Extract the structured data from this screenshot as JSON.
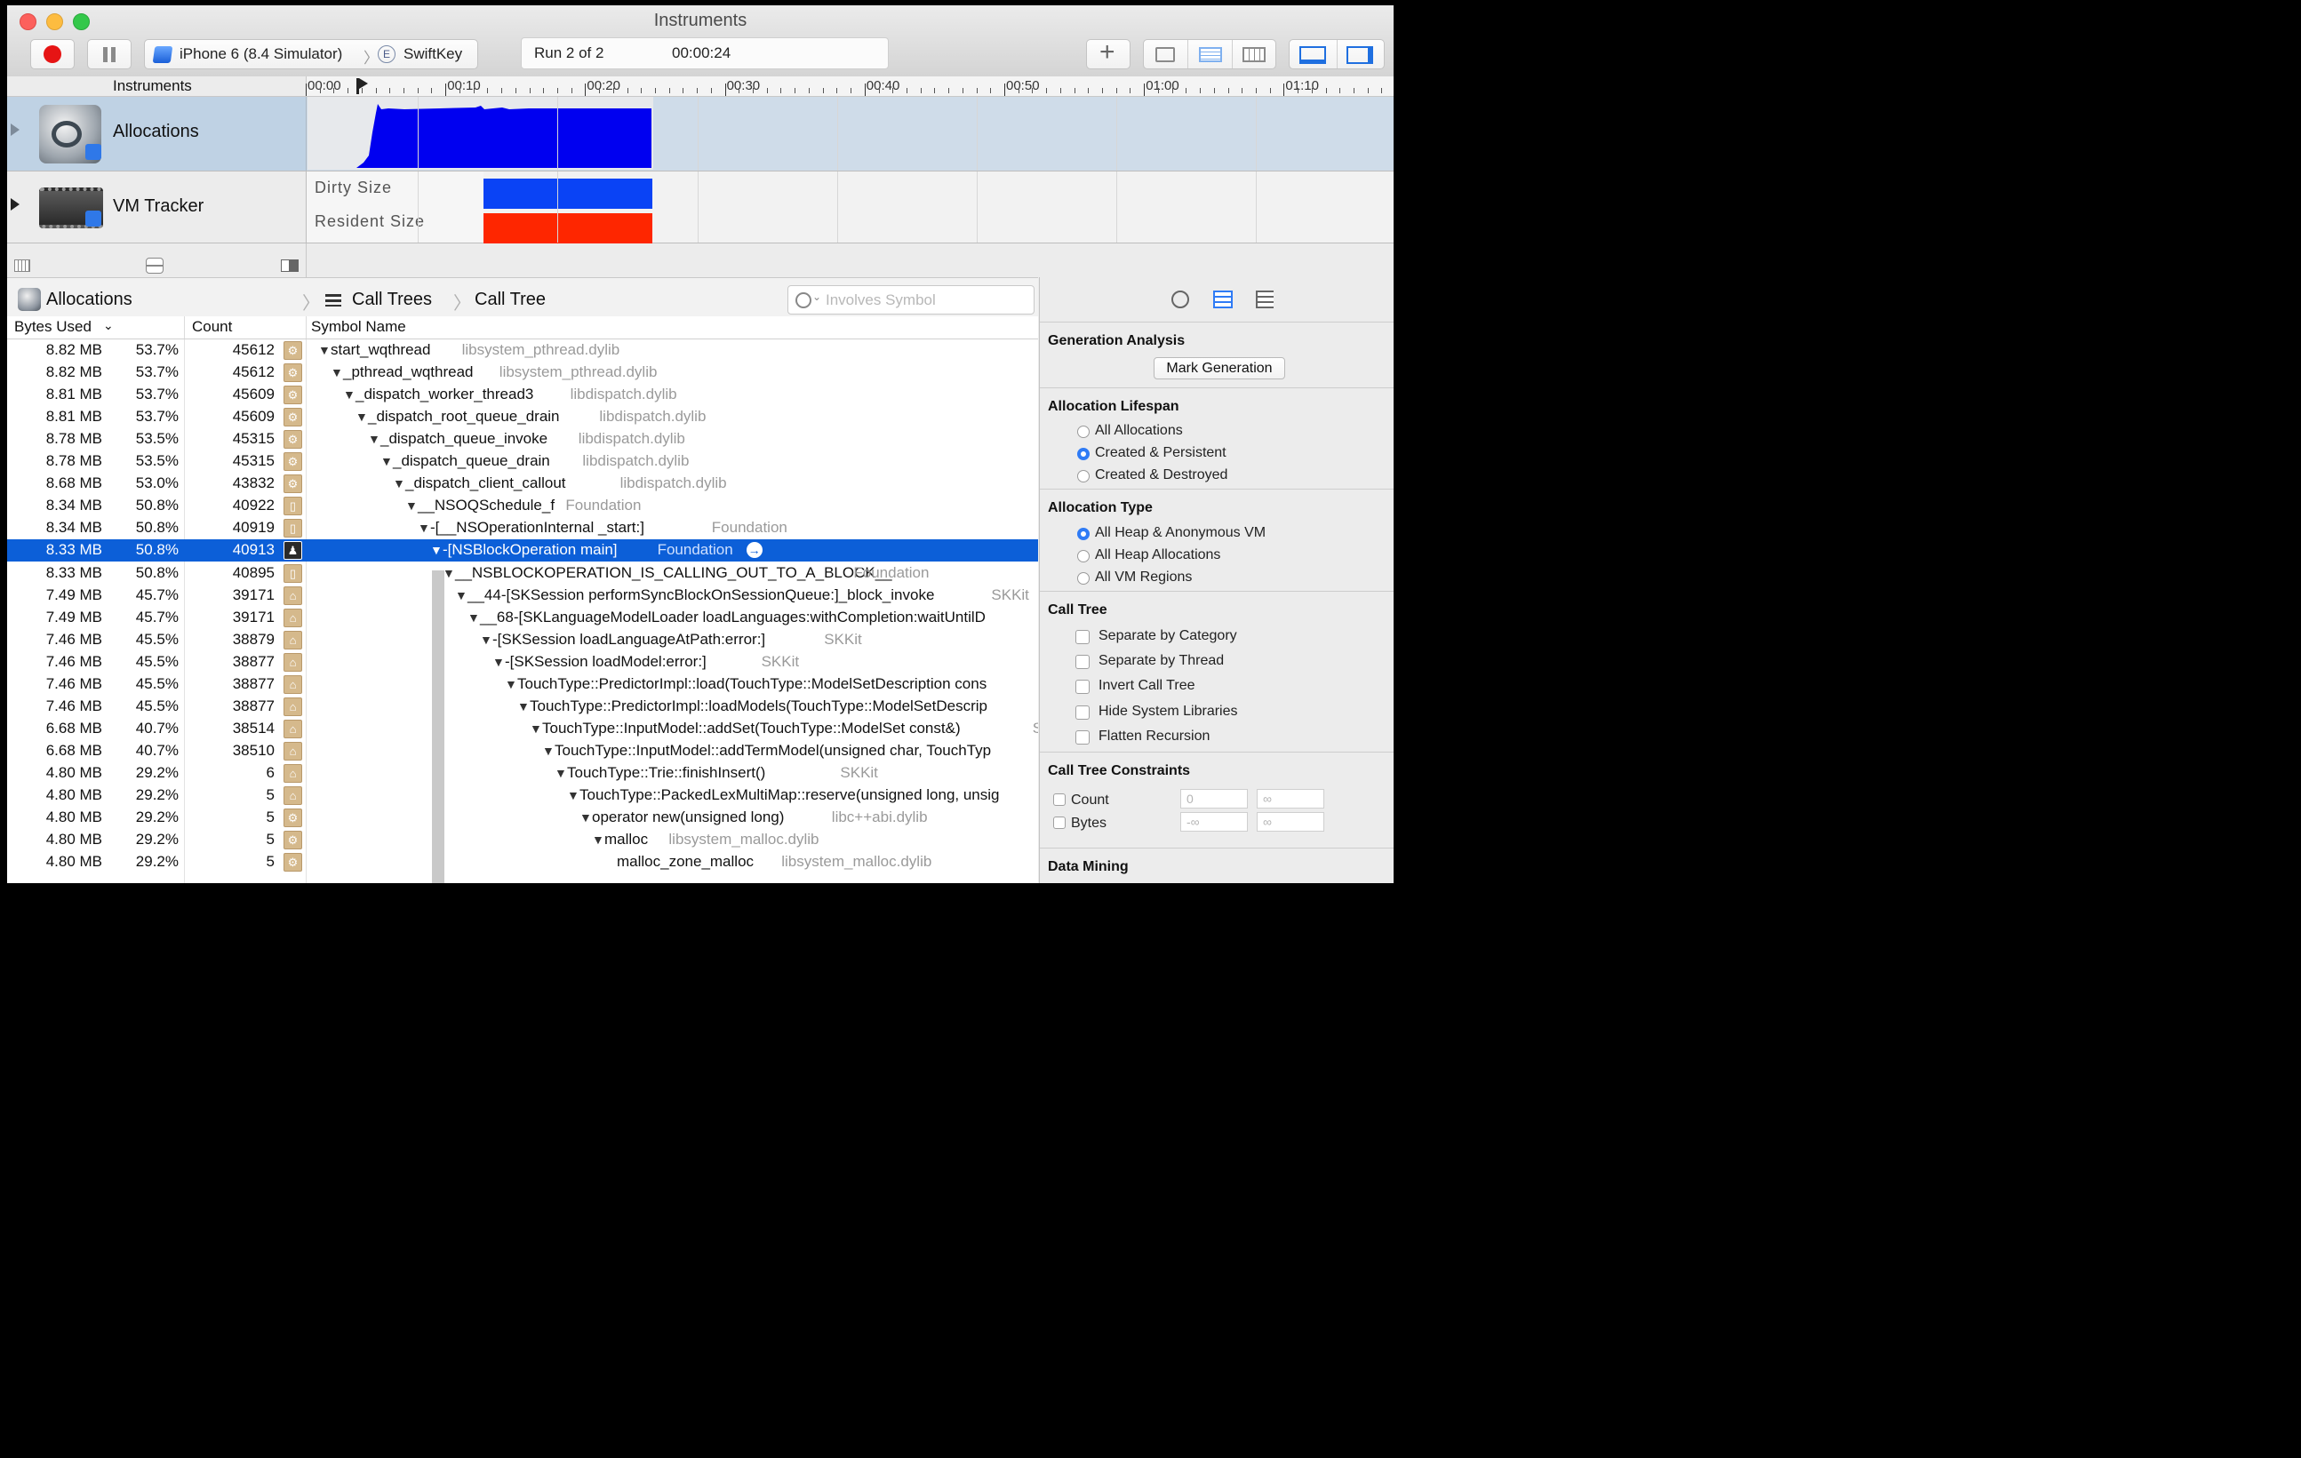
{
  "window": {
    "title": "Instruments"
  },
  "toolbar": {
    "device": "iPhone 6 (8.4 Simulator)",
    "target_badge": "E",
    "target": "SwiftKey",
    "run": "Run 2 of 2",
    "time": "00:00:24",
    "add": "+"
  },
  "timeline": {
    "header": "Instruments",
    "ticks": [
      "00:00",
      "00:10",
      "00:20",
      "00:30",
      "00:40",
      "00:50",
      "01:00",
      "01:10"
    ]
  },
  "tracks": {
    "allocations": "Allocations",
    "vm_tracker": "VM Tracker",
    "dirty_size": "Dirty Size",
    "resident_size": "Resident Size"
  },
  "colors": {
    "allocations_fill": "#0000f0",
    "dirty": "#0a43f5",
    "resident": "#fe2600",
    "selection": "#0c5fd8"
  },
  "navbar": {
    "instrument": "Allocations",
    "view": "Call Trees",
    "subview": "Call Tree",
    "search_placeholder": "Involves Symbol"
  },
  "columns": {
    "bytes": "Bytes Used",
    "count": "Count",
    "symbol": "Symbol Name"
  },
  "rows": [
    {
      "bytes": "8.82 MB",
      "pct": "53.7%",
      "count": "45612",
      "sym": "start_wqthread",
      "lib": "libsystem_pthread.dylib",
      "icon": "gear",
      "depth": 0,
      "arrow": "▼"
    },
    {
      "bytes": "8.82 MB",
      "pct": "53.7%",
      "count": "45612",
      "sym": "_pthread_wqthread",
      "lib": "libsystem_pthread.dylib",
      "icon": "gear",
      "depth": 1,
      "arrow": "▼"
    },
    {
      "bytes": "8.81 MB",
      "pct": "53.7%",
      "count": "45609",
      "sym": "_dispatch_worker_thread3",
      "lib": "libdispatch.dylib",
      "icon": "gear",
      "depth": 2,
      "arrow": "▼"
    },
    {
      "bytes": "8.81 MB",
      "pct": "53.7%",
      "count": "45609",
      "sym": "_dispatch_root_queue_drain",
      "lib": "libdispatch.dylib",
      "icon": "gear",
      "depth": 3,
      "arrow": "▼"
    },
    {
      "bytes": "8.78 MB",
      "pct": "53.5%",
      "count": "45315",
      "sym": "_dispatch_queue_invoke",
      "lib": "libdispatch.dylib",
      "icon": "gear",
      "depth": 4,
      "arrow": "▼"
    },
    {
      "bytes": "8.78 MB",
      "pct": "53.5%",
      "count": "45315",
      "sym": "_dispatch_queue_drain",
      "lib": "libdispatch.dylib",
      "icon": "gear",
      "depth": 5,
      "arrow": "▼"
    },
    {
      "bytes": "8.68 MB",
      "pct": "53.0%",
      "count": "43832",
      "sym": "_dispatch_client_callout",
      "lib": "libdispatch.dylib",
      "icon": "gear",
      "depth": 6,
      "arrow": "▼"
    },
    {
      "bytes": "8.34 MB",
      "pct": "50.8%",
      "count": "40922",
      "sym": "__NSOQSchedule_f",
      "lib": "Foundation",
      "icon": "doc",
      "depth": 7,
      "arrow": "▼"
    },
    {
      "bytes": "8.34 MB",
      "pct": "50.8%",
      "count": "40919",
      "sym": "-[__NSOperationInternal _start:]",
      "lib": "Foundation",
      "icon": "doc",
      "depth": 8,
      "arrow": "▼"
    },
    {
      "bytes": "8.33 MB",
      "pct": "50.8%",
      "count": "40913",
      "sym": "-[NSBlockOperation main]",
      "lib": "Foundation",
      "icon": "user",
      "depth": 9,
      "arrow": "▼",
      "selected": true
    },
    {
      "bytes": "8.33 MB",
      "pct": "50.8%",
      "count": "40895",
      "sym": "__NSBLOCKOPERATION_IS_CALLING_OUT_TO_A_BLOCK__",
      "lib": "Foundation",
      "icon": "doc",
      "depth": 10,
      "arrow": "▼"
    },
    {
      "bytes": "7.49 MB",
      "pct": "45.7%",
      "count": "39171",
      "sym": "__44-[SKSession performSyncBlockOnSessionQueue:]_block_invoke",
      "lib": "SKKit",
      "icon": "bldg",
      "depth": 11,
      "arrow": "▼"
    },
    {
      "bytes": "7.49 MB",
      "pct": "45.7%",
      "count": "39171",
      "sym": "__68-[SKLanguageModelLoader loadLanguages:withCompletion:waitUntilD",
      "lib": "",
      "icon": "bldg",
      "depth": 12,
      "arrow": "▼"
    },
    {
      "bytes": "7.46 MB",
      "pct": "45.5%",
      "count": "38879",
      "sym": "-[SKSession loadLanguageAtPath:error:]",
      "lib": "SKKit",
      "icon": "bldg",
      "depth": 13,
      "arrow": "▼"
    },
    {
      "bytes": "7.46 MB",
      "pct": "45.5%",
      "count": "38877",
      "sym": "-[SKSession loadModel:error:]",
      "lib": "SKKit",
      "icon": "bldg",
      "depth": 14,
      "arrow": "▼"
    },
    {
      "bytes": "7.46 MB",
      "pct": "45.5%",
      "count": "38877",
      "sym": "TouchType::PredictorImpl::load(TouchType::ModelSetDescription cons",
      "lib": "",
      "icon": "bldg",
      "depth": 15,
      "arrow": "▼"
    },
    {
      "bytes": "7.46 MB",
      "pct": "45.5%",
      "count": "38877",
      "sym": "TouchType::PredictorImpl::loadModels(TouchType::ModelSetDescrip",
      "lib": "",
      "icon": "bldg",
      "depth": 16,
      "arrow": "▼"
    },
    {
      "bytes": "6.68 MB",
      "pct": "40.7%",
      "count": "38514",
      "sym": "TouchType::InputModel::addSet(TouchType::ModelSet const&)",
      "lib": "SK",
      "icon": "bldg",
      "depth": 17,
      "arrow": "▼"
    },
    {
      "bytes": "6.68 MB",
      "pct": "40.7%",
      "count": "38510",
      "sym": "TouchType::InputModel::addTermModel(unsigned char, TouchTyp",
      "lib": "",
      "icon": "bldg",
      "depth": 18,
      "arrow": "▼"
    },
    {
      "bytes": "4.80 MB",
      "pct": "29.2%",
      "count": "6",
      "sym": "TouchType::Trie::finishInsert()",
      "lib": "SKKit",
      "icon": "bldg",
      "depth": 19,
      "arrow": "▼"
    },
    {
      "bytes": "4.80 MB",
      "pct": "29.2%",
      "count": "5",
      "sym": "TouchType::PackedLexMultiMap::reserve(unsigned long, unsig",
      "lib": "",
      "icon": "bldg",
      "depth": 20,
      "arrow": "▼"
    },
    {
      "bytes": "4.80 MB",
      "pct": "29.2%",
      "count": "5",
      "sym": "operator new(unsigned long)",
      "lib": "libc++abi.dylib",
      "icon": "gear",
      "depth": 21,
      "arrow": "▼"
    },
    {
      "bytes": "4.80 MB",
      "pct": "29.2%",
      "count": "5",
      "sym": "malloc",
      "lib": "libsystem_malloc.dylib",
      "icon": "gear",
      "depth": 22,
      "arrow": "▼"
    },
    {
      "bytes": "4.80 MB",
      "pct": "29.2%",
      "count": "5",
      "sym": "malloc_zone_malloc",
      "lib": "libsystem_malloc.dylib",
      "icon": "gear",
      "depth": 23,
      "arrow": ""
    }
  ],
  "inspector": {
    "generation_title": "Generation Analysis",
    "mark_generation": "Mark Generation",
    "lifespan_title": "Allocation Lifespan",
    "lifespan": [
      "All Allocations",
      "Created & Persistent",
      "Created & Destroyed"
    ],
    "lifespan_selected": 1,
    "type_title": "Allocation Type",
    "types": [
      "All Heap & Anonymous VM",
      "All Heap Allocations",
      "All VM Regions"
    ],
    "type_selected": 0,
    "calltree_title": "Call Tree",
    "calltree_opts": [
      "Separate by Category",
      "Separate by Thread",
      "Invert Call Tree",
      "Hide System Libraries",
      "Flatten Recursion"
    ],
    "constraints_title": "Call Tree Constraints",
    "count_label": "Count",
    "bytes_label": "Bytes",
    "count_min": "0",
    "count_max": "∞",
    "bytes_min": "-∞",
    "bytes_max": "∞",
    "datamining_title": "Data Mining"
  }
}
